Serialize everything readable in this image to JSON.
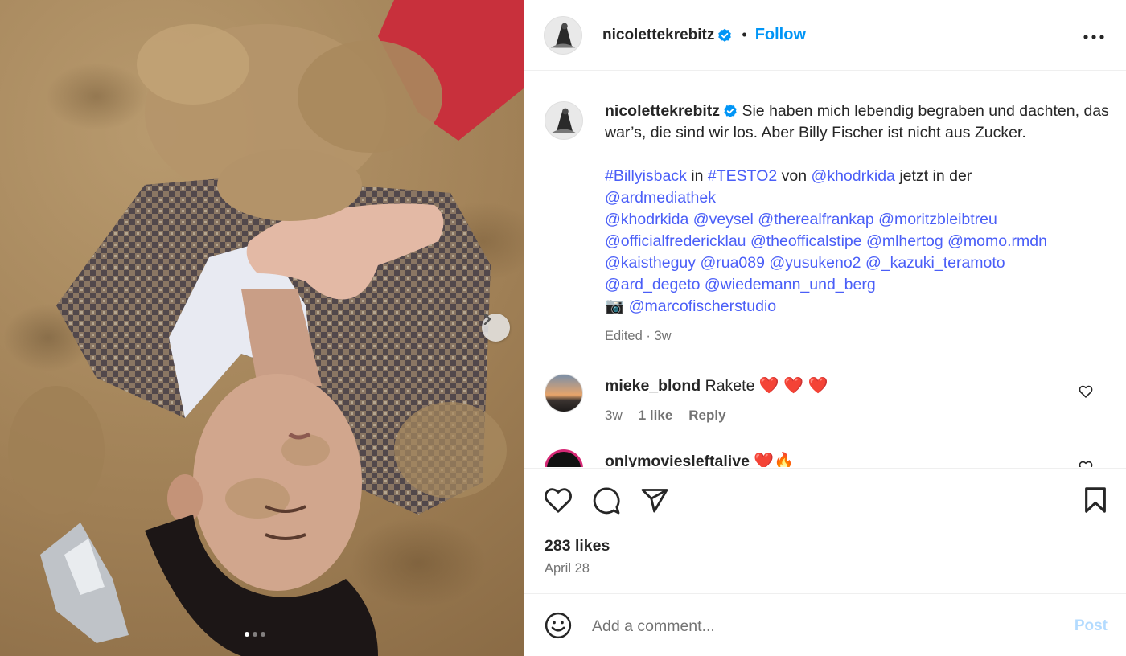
{
  "post": {
    "author": "nicolettekrebitz",
    "follow_label": "Follow",
    "separator": "•",
    "more_label": "•••"
  },
  "media": {
    "description_icon": "photo-carousel",
    "slide_count": 3,
    "active_slide": 1
  },
  "caption": {
    "username": "nicolettekrebitz",
    "text_line": "Sie haben mich lebendig begraben und dachten, das war’s, die sind wir los. Aber Billy Fischer ist nicht aus Zucker.",
    "hashtag1": "#Billyisback",
    "word_in": "in",
    "hashtag2": "#TESTO2",
    "word_von": "von",
    "mention_khodrkida": "@khodrkida",
    "word_jetzt": "jetzt in der",
    "mention_ardmediathek": "@ardmediathek",
    "mentions_line1": [
      "@khodrkida",
      "@veysel",
      "@therealfrankap",
      "@moritzbleibtreu"
    ],
    "mentions_line2": [
      "@officialfredericklau",
      "@theofficalstipe",
      "@mlhertog",
      "@momo.rmdn"
    ],
    "mentions_line3": [
      "@kaistheguy",
      "@rua089",
      "@yusukeno2",
      "@_kazuki_teramoto"
    ],
    "mentions_line4": [
      "@ard_degeto",
      "@wiedemann_und_berg"
    ],
    "camera_emoji": "📷",
    "photographer": "@marcofischerstudio",
    "meta": "Edited · 3w"
  },
  "comments": [
    {
      "username": "mieke_blond",
      "text": "Rakete",
      "hearts": "❤️ ❤️ ❤️",
      "age": "3w",
      "likes": "1 like",
      "reply": "Reply"
    },
    {
      "username": "onlymoviesleftalive",
      "text": "",
      "hearts": "❤️🔥"
    }
  ],
  "actions": {
    "likes": "283 likes",
    "date": "April 28"
  },
  "add_comment": {
    "placeholder": "Add a comment...",
    "post_label": "Post"
  },
  "colors": {
    "link": "#4a5ef7",
    "follow": "#0095f6",
    "post_disabled": "#b3dbff",
    "verified": "#0095f6"
  }
}
